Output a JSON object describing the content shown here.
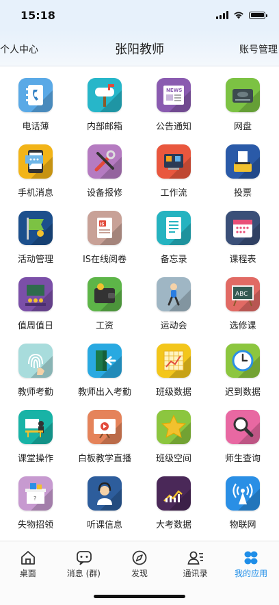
{
  "status_bar": {
    "time": "15:18"
  },
  "header": {
    "left": "个人中心",
    "title": "张阳教师",
    "right": "账号管理"
  },
  "apps": [
    {
      "label": "电话薄",
      "icon": "phonebook-icon",
      "color": "#5aa9e6"
    },
    {
      "label": "内部邮箱",
      "icon": "mailbox-icon",
      "color": "#27b6c9"
    },
    {
      "label": "公告通知",
      "icon": "news-icon",
      "color": "#8a5bb0"
    },
    {
      "label": "网盘",
      "icon": "disk-icon",
      "color": "#7cc243"
    },
    {
      "label": "手机消息",
      "icon": "message-icon",
      "color": "#f2b418"
    },
    {
      "label": "设备报修",
      "icon": "tools-icon",
      "color": "#b57bc1"
    },
    {
      "label": "工作流",
      "icon": "workflow-icon",
      "color": "#e9573e"
    },
    {
      "label": "投票",
      "icon": "vote-icon",
      "color": "#2a5aa8"
    },
    {
      "label": "活动管理",
      "icon": "flag-icon",
      "color": "#1c4f8c"
    },
    {
      "label": "IS在线阅卷",
      "icon": "exam-icon",
      "color": "#c8a197"
    },
    {
      "label": "备忘录",
      "icon": "memo-icon",
      "color": "#25b3c0"
    },
    {
      "label": "课程表",
      "icon": "calendar-icon",
      "color": "#3a4f78"
    },
    {
      "label": "值周值日",
      "icon": "duty-icon",
      "color": "#7b4fa8"
    },
    {
      "label": "工资",
      "icon": "wallet-icon",
      "color": "#5db548"
    },
    {
      "label": "运动会",
      "icon": "runner-icon",
      "color": "#9fb6c4"
    },
    {
      "label": "选修课",
      "icon": "blackboard-icon",
      "color": "#e16a64"
    },
    {
      "label": "教师考勤",
      "icon": "fingerprint-icon",
      "color": "#a8dcdc"
    },
    {
      "label": "教师出入考勤",
      "icon": "door-icon",
      "color": "#29a9e1"
    },
    {
      "label": "班级数据",
      "icon": "chart-icon",
      "color": "#f3c61b"
    },
    {
      "label": "迟到数据",
      "icon": "clock-icon",
      "color": "#8cc63f"
    },
    {
      "label": "课堂操作",
      "icon": "classroom-icon",
      "color": "#18b3a6"
    },
    {
      "label": "白板教学直播",
      "icon": "video-icon",
      "color": "#e5835a"
    },
    {
      "label": "班级空间",
      "icon": "star-icon",
      "color": "#8cc63f"
    },
    {
      "label": "师生查询",
      "icon": "search-icon",
      "color": "#e868a2"
    },
    {
      "label": "失物招领",
      "icon": "lost-box-icon",
      "color": "#c79ad0"
    },
    {
      "label": "听课信息",
      "icon": "headset-icon",
      "color": "#2d5d9c"
    },
    {
      "label": "大考数据",
      "icon": "trend-icon",
      "color": "#4a2858"
    },
    {
      "label": "物联网",
      "icon": "antenna-icon",
      "color": "#2a8fe5"
    }
  ],
  "tabs": [
    {
      "label": "桌面",
      "icon": "home-icon"
    },
    {
      "label": "消息 (群)",
      "icon": "chat-icon"
    },
    {
      "label": "发现",
      "icon": "compass-icon"
    },
    {
      "label": "通讯录",
      "icon": "contacts-icon"
    },
    {
      "label": "我的应用",
      "icon": "apps-icon",
      "active": true
    }
  ],
  "accent_color": "#1f8ee8"
}
